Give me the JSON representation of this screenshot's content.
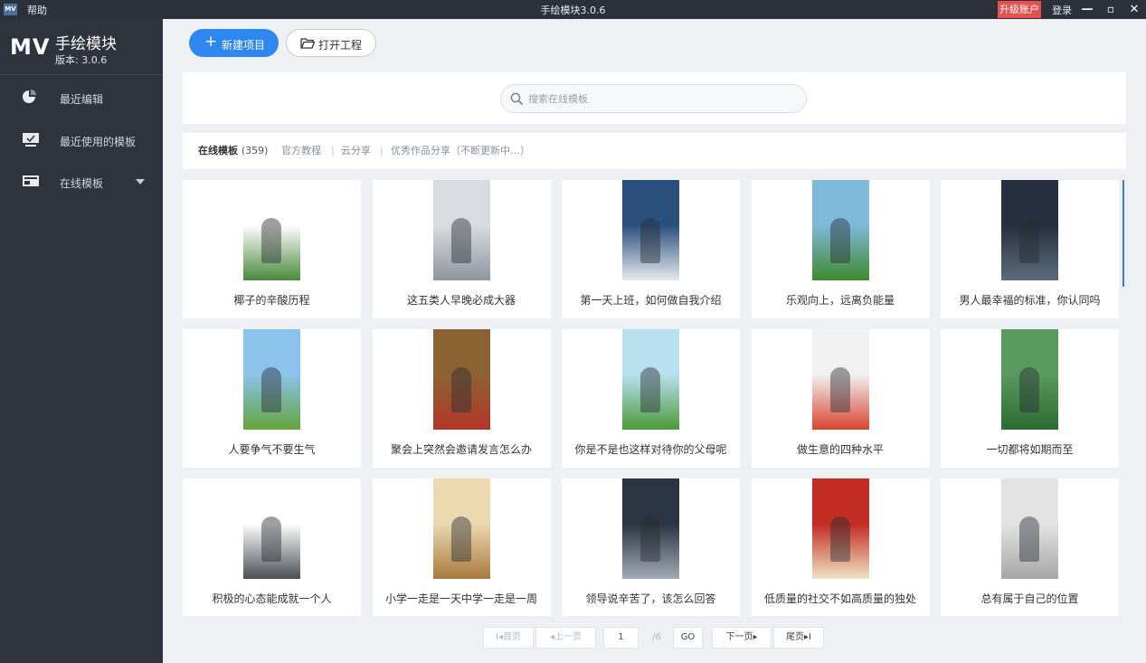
{
  "window": {
    "logo": "MV",
    "help_menu": "帮助",
    "title": "手绘模块3.0.6",
    "upgrade": "升级账户",
    "login": "登录",
    "controls": [
      "—",
      "▫",
      "✕"
    ]
  },
  "brand": {
    "mark": "MV",
    "name": "手绘模块",
    "version": "版本: 3.0.6"
  },
  "sidebar": {
    "items": [
      {
        "label": "最近编辑",
        "icon": "pie-chart-icon"
      },
      {
        "label": "最近使用的模板",
        "icon": "monitor-check-icon"
      },
      {
        "label": "在线模板",
        "icon": "template-window-icon"
      }
    ]
  },
  "toolbar": {
    "new_project": "新建项目",
    "open_project": "打开工程"
  },
  "search": {
    "placeholder": "搜索在线模板",
    "value": ""
  },
  "filters": {
    "active": "在线模板",
    "active_count": "(359)",
    "items": [
      "官方教程",
      "云分享",
      "优秀作品分享（不断更新中…）"
    ],
    "separator": "|"
  },
  "templates": [
    {
      "title": "椰子的辛酸历程",
      "thumb_colors": [
        "#ffffff",
        "#4a8a3c"
      ]
    },
    {
      "title": "这五类人早晚必成大器",
      "thumb_colors": [
        "#d8dce0",
        "#8e96a0"
      ]
    },
    {
      "title": "第一天上班，如何做自我介绍",
      "thumb_colors": [
        "#2a4f7d",
        "#e6e9ee"
      ]
    },
    {
      "title": "乐观向上，远离负能量",
      "thumb_colors": [
        "#7fb9d9",
        "#3f8a2e"
      ]
    },
    {
      "title": "男人最幸福的标准，你认同吗",
      "thumb_colors": [
        "#252f3d",
        "#5c6c7d"
      ]
    },
    {
      "title": "人要争气不要生气",
      "thumb_colors": [
        "#8cc3ec",
        "#64a43a"
      ]
    },
    {
      "title": "聚会上突然会邀请发言怎么办",
      "thumb_colors": [
        "#8c6232",
        "#b33628"
      ]
    },
    {
      "title": "你是不是也这样对待你的父母呢",
      "thumb_colors": [
        "#b9e0ee",
        "#4b9a3b"
      ]
    },
    {
      "title": "做生意的四种水平",
      "thumb_colors": [
        "#f2f2f2",
        "#d94430"
      ]
    },
    {
      "title": "一切都将如期而至",
      "thumb_colors": [
        "#5a9a5e",
        "#2d6a32"
      ]
    },
    {
      "title": "积极的心态能成就一个人",
      "thumb_colors": [
        "#ffffff",
        "#4b4f55"
      ]
    },
    {
      "title": "小学一走是一天中学一走是一周",
      "thumb_colors": [
        "#ecd9b0",
        "#a7793d"
      ]
    },
    {
      "title": "领导说辛苦了，该怎么回答",
      "thumb_colors": [
        "#2b3442",
        "#a2aab4"
      ]
    },
    {
      "title": "低质量的社交不如高质量的独处",
      "thumb_colors": [
        "#c22c22",
        "#f0e2c5"
      ]
    },
    {
      "title": "总有属于自己的位置",
      "thumb_colors": [
        "#e3e3e3",
        "#a7a7a7"
      ]
    }
  ],
  "pager": {
    "first": "I◂首页",
    "prev": "◂上一页",
    "current": "1",
    "total": "/6",
    "go": "GO",
    "next": "下一页▸",
    "last": "尾页▸I"
  },
  "colors": {
    "accent": "#2e86f0",
    "upgrade": "#e55050",
    "sidebar": "#2f333b"
  }
}
